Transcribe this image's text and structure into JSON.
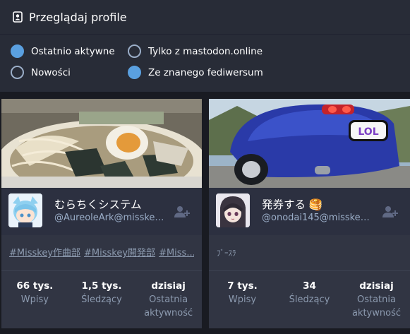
{
  "header": {
    "title": "Przeglądaj profile",
    "icon": "address-book-icon"
  },
  "filters": {
    "recently_active": {
      "label": "Ostatnio aktywne",
      "checked": true
    },
    "only_local": {
      "label": "Tylko z mastodon.online",
      "checked": false
    },
    "new": {
      "label": "Nowości",
      "checked": false
    },
    "known_fediverse": {
      "label": "Ze znanego fediwersum",
      "checked": true
    }
  },
  "accent_color": "#5aa0e0",
  "cards": [
    {
      "display_name": "むらちくシステム",
      "account": "@AureoleArk@misskey....",
      "bio_tags": [
        "#Misskey作曲部",
        "#Misskey開発部",
        "#Miss..."
      ],
      "stats": [
        {
          "value": "66 tys.",
          "label": "Wpisy"
        },
        {
          "value": "1,5 tys.",
          "label": "Śledzący"
        },
        {
          "value": "dzisiaj",
          "label": "Ostatnia aktywność"
        }
      ]
    },
    {
      "display_name": "発券する 🥞",
      "account": "@onodai145@misskey.o...",
      "bio_text": "ﾌﾞｰｽﾗ",
      "stats": [
        {
          "value": "7 tys.",
          "label": "Wpisy"
        },
        {
          "value": "34",
          "label": "Śledzący"
        },
        {
          "value": "dzisiaj",
          "label": "Ostatnia aktywność"
        }
      ]
    }
  ]
}
